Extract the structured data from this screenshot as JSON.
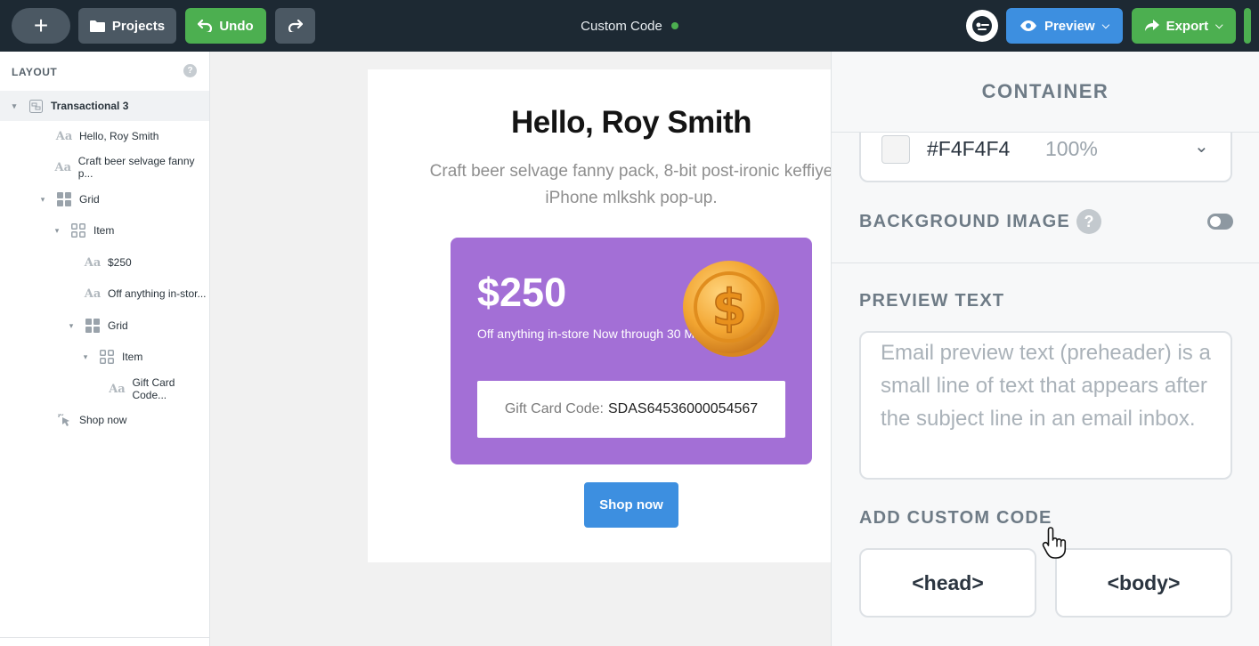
{
  "topbar": {
    "add_icon": "plus-icon",
    "projects_label": "Projects",
    "undo_label": "Undo",
    "title": "Custom Code",
    "status_color": "#4caf50",
    "preview_label": "Preview",
    "export_label": "Export"
  },
  "sidebar": {
    "heading": "LAYOUT",
    "help": "?",
    "items": [
      {
        "label": "Transactional 3",
        "icon": "template-icon",
        "depth": 0,
        "caret": true,
        "active": true
      },
      {
        "label": "Hello, Roy Smith",
        "icon": "text-icon",
        "depth": 1,
        "caret": false
      },
      {
        "label": "Craft beer selvage fanny p...",
        "icon": "text-icon",
        "depth": 1,
        "caret": false
      },
      {
        "label": "Grid",
        "icon": "grid-icon",
        "depth": 1,
        "caret": true
      },
      {
        "label": "Item",
        "icon": "item-icon",
        "depth": 2,
        "caret": true
      },
      {
        "label": "$250",
        "icon": "text-icon",
        "depth": 3,
        "caret": false
      },
      {
        "label": "Off anything in-stor...",
        "icon": "text-icon",
        "depth": 3,
        "caret": false
      },
      {
        "label": "Grid",
        "icon": "grid-icon",
        "depth": 3,
        "caret": true
      },
      {
        "label": "Item",
        "icon": "item-icon",
        "depth": 4,
        "caret": true
      },
      {
        "label": "Gift Card Code...",
        "icon": "text-icon",
        "depth": 5,
        "caret": false
      },
      {
        "label": "Shop now",
        "icon": "click-icon",
        "depth": 1,
        "caret": false
      }
    ]
  },
  "email": {
    "heading": "Hello, Roy Smith",
    "subtext": "Craft beer selvage fanny pack, 8-bit post-ironic keffiye iPhone mlkshk pop-up.",
    "card_color": "#a36fd6",
    "price": "$250",
    "offer": "Off anything in-store Now through 30 May",
    "code_label": "Gift Card Code:",
    "code_value": "SDAS64536000054567",
    "shop_label": "Shop now",
    "coin_icon": "dollar-coin-icon"
  },
  "panel": {
    "title": "CONTAINER",
    "color_hex": "#F4F4F4",
    "color_opacity": "100%",
    "bg_image_label": "BACKGROUND IMAGE",
    "bg_image_enabled": false,
    "help": "?",
    "preview_text_label": "PREVIEW TEXT",
    "preview_placeholder": "Email preview text (preheader) is a small line of text that appears after the subject line in an email inbox.",
    "custom_code_label": "ADD CUSTOM CODE",
    "head_label": "<head>",
    "body_label": "<body>"
  }
}
